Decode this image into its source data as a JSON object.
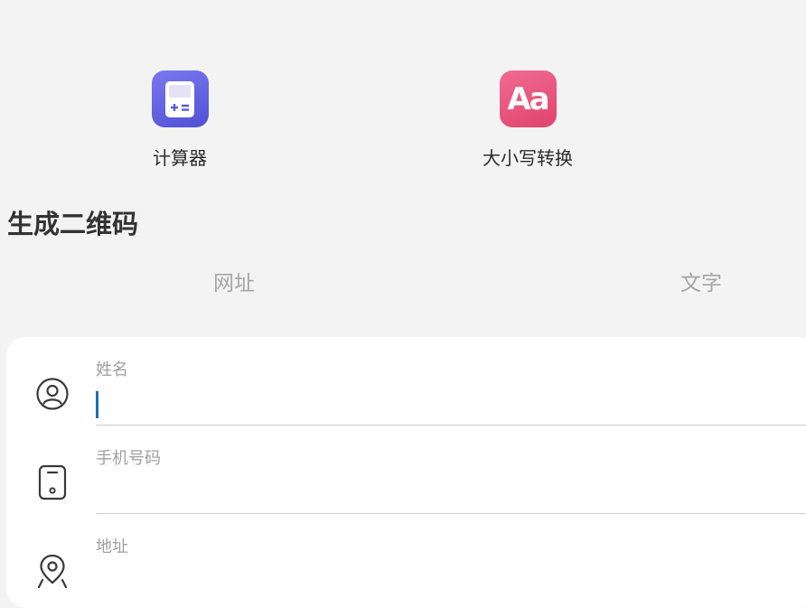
{
  "apps": [
    {
      "label": "计算器",
      "icon": "calculator-icon",
      "color": "#5b5be0"
    },
    {
      "label": "大小写转换",
      "icon": "case-convert-icon",
      "color": "#e8587f",
      "icon_text": "Aa"
    }
  ],
  "qr_section": {
    "title": "生成二维码",
    "tabs": [
      "网址",
      "文字"
    ]
  },
  "form": {
    "fields": [
      {
        "label": "姓名",
        "value": "",
        "icon": "person-icon"
      },
      {
        "label": "手机号码",
        "value": "",
        "icon": "phone-icon"
      },
      {
        "label": "地址",
        "value": "",
        "icon": "location-pin-icon"
      }
    ]
  },
  "colors": {
    "background": "#f3f3f3",
    "card": "#ffffff",
    "caret": "#1f6fb8"
  }
}
